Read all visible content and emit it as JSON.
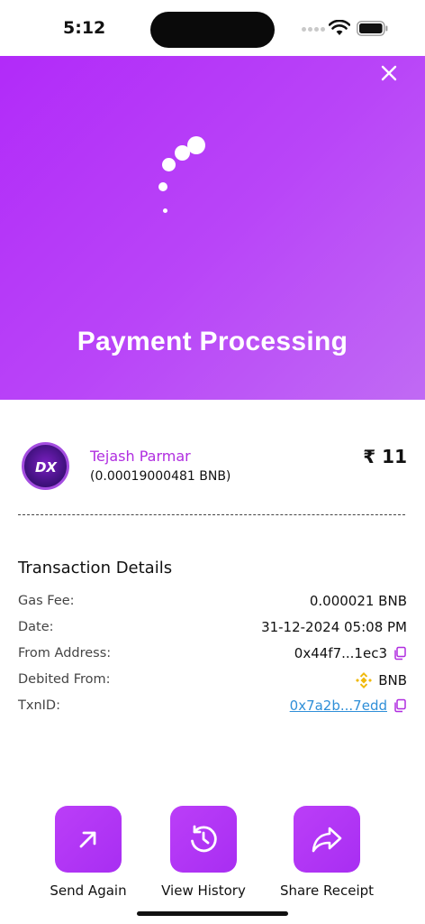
{
  "status_bar": {
    "time": "5:12"
  },
  "header": {
    "title": "Payment Processing",
    "close_icon": "close-icon"
  },
  "recipient": {
    "name": "Tejash Parmar",
    "crypto_amount": "(0.00019000481 BNB)",
    "fiat_amount": "₹ 11",
    "avatar_icon": "dx-logo"
  },
  "details": {
    "title": "Transaction Details",
    "rows": [
      {
        "label": "Gas Fee:",
        "value": "0.000021 BNB"
      },
      {
        "label": "Date:",
        "value": "31-12-2024 05:08 PM"
      },
      {
        "label": "From Address:",
        "value": "0x44f7...1ec3"
      },
      {
        "label": "Debited From:",
        "value": "BNB"
      },
      {
        "label": "TxnID:",
        "value": "0x7a2b...7edd"
      }
    ]
  },
  "actions": [
    {
      "label": "Send Again",
      "icon": "arrow-up-right-icon"
    },
    {
      "label": "View History",
      "icon": "history-icon"
    },
    {
      "label": "Share Receipt",
      "icon": "share-icon"
    }
  ],
  "colors": {
    "accent": "#b02de0",
    "header_gradient_start": "#b128f9",
    "header_gradient_end": "#c06af4",
    "link": "#2f8fd8",
    "bnb": "#f0b90b"
  }
}
